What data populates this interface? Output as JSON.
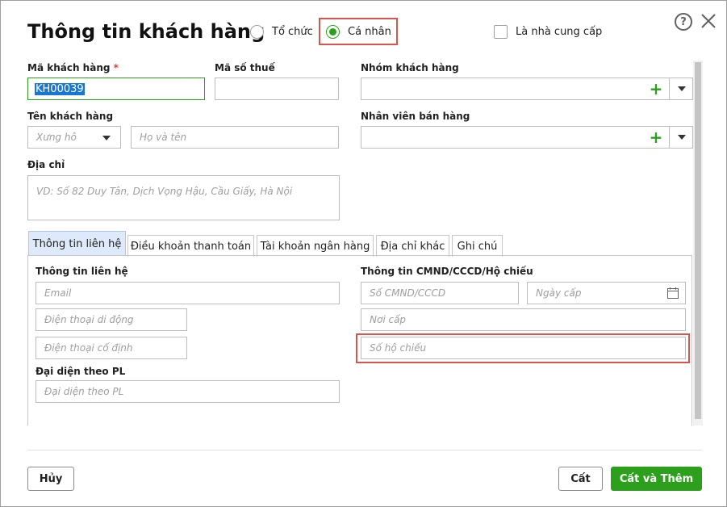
{
  "dialog": {
    "title": "Thông tin khách hàng",
    "type_options": [
      {
        "label": "Tổ chức",
        "checked": false
      },
      {
        "label": "Cá nhân",
        "checked": true
      }
    ],
    "supplier_checkbox": {
      "label": "Là nhà cung cấp",
      "checked": false
    },
    "help_icon": "?"
  },
  "fields": {
    "customer_code": {
      "label": "Mã khách hàng",
      "required_mark": "*",
      "value": "KH00039"
    },
    "tax_code": {
      "label": "Mã số thuế",
      "value": ""
    },
    "customer_group": {
      "label": "Nhóm khách hàng",
      "value": "",
      "add_symbol": "+"
    },
    "customer_name": {
      "label": "Tên khách hàng",
      "salutation_placeholder": "Xưng hô",
      "name_placeholder": "Họ và tên"
    },
    "sales_staff": {
      "label": "Nhân viên bán hàng",
      "value": "",
      "add_symbol": "+"
    },
    "address": {
      "label": "Địa chỉ",
      "placeholder": "VD: Số 82 Duy Tân, Dịch Vọng Hậu, Cầu Giấy, Hà Nội"
    }
  },
  "tabs": [
    {
      "label": "Thông tin liên hệ",
      "active": true
    },
    {
      "label": "Điều khoản thanh toán",
      "active": false
    },
    {
      "label": "Tài khoản ngân hàng",
      "active": false
    },
    {
      "label": "Địa chỉ khác",
      "active": false
    },
    {
      "label": "Ghi chú",
      "active": false
    }
  ],
  "contact": {
    "section_label": "Thông tin liên hệ",
    "email_placeholder": "Email",
    "mobile_placeholder": "Điện thoại di động",
    "landline_placeholder": "Điện thoại cố định",
    "legal_rep_label": "Đại diện theo PL",
    "legal_rep_placeholder": "Đại diện theo PL"
  },
  "id_info": {
    "section_label": "Thông tin CMND/CCCD/Hộ chiếu",
    "id_number_placeholder": "Số CMND/CCCD",
    "issue_date_placeholder": "Ngày cấp",
    "issue_place_placeholder": "Nơi cấp",
    "passport_placeholder": "Số hộ chiếu"
  },
  "footer": {
    "cancel_label": "Hủy",
    "save_label": "Cất",
    "save_add_label": "Cất và Thêm"
  },
  "colors": {
    "accent": "#2ca01c",
    "highlight": "#d9534f",
    "selection": "#1976d2",
    "active_tab": "#deeafb"
  }
}
